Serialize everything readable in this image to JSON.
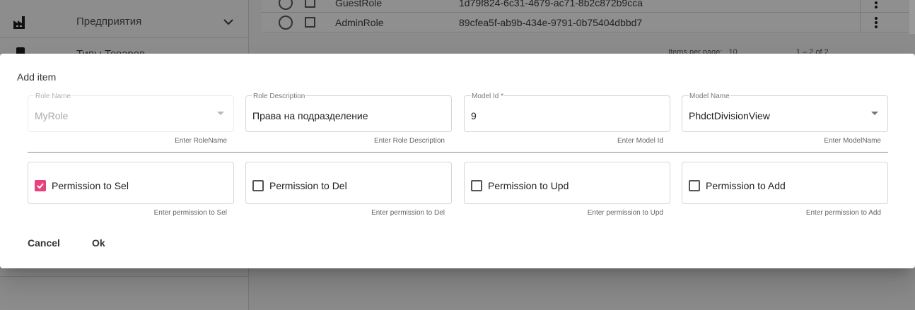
{
  "sidebar": {
    "items": [
      {
        "label": "Предприятия",
        "icon": "factory-icon"
      },
      {
        "label": "Типы Товаров",
        "icon": "phone-icon"
      }
    ]
  },
  "table": {
    "rows": [
      {
        "name": "GuestRole",
        "id": "1d79f824-6c31-4679-ac71-8b2c872b9cca"
      },
      {
        "name": "AdminRole",
        "id": "89cfea5f-ab9b-434e-9791-0b75404dbbd7"
      }
    ],
    "paginator": {
      "items_per_page_label": "Items per page:",
      "page_size": "10",
      "range": "1 – 2 of 2"
    }
  },
  "dialog": {
    "title": "Add item",
    "fields": [
      {
        "label": "Role Name",
        "value": "MyRole",
        "hint": "Enter RoleName",
        "disabled": true,
        "dropdown": true
      },
      {
        "label": "Role Description",
        "value": "Права на подразделение",
        "hint": "Enter Role Description"
      },
      {
        "label": "Model Id *",
        "value": "9",
        "hint": "Enter Model Id"
      },
      {
        "label": "Model Name",
        "value": "PhdctDivisionView",
        "hint": "Enter ModelName",
        "dropdown": true
      }
    ],
    "permissions": [
      {
        "label": "Permission to Sel",
        "checked": true,
        "hint": "Enter permission to Sel"
      },
      {
        "label": "Permission to Del",
        "checked": false,
        "hint": "Enter permission to Del"
      },
      {
        "label": "Permission to Upd",
        "checked": false,
        "hint": "Enter permission to Upd"
      },
      {
        "label": "Permission to Add",
        "checked": false,
        "hint": "Enter permission to Add"
      }
    ],
    "cancel_label": "Cancel",
    "ok_label": "Ok"
  },
  "colors": {
    "accent": "#e8417e",
    "overlay": "#8a8a8a"
  }
}
